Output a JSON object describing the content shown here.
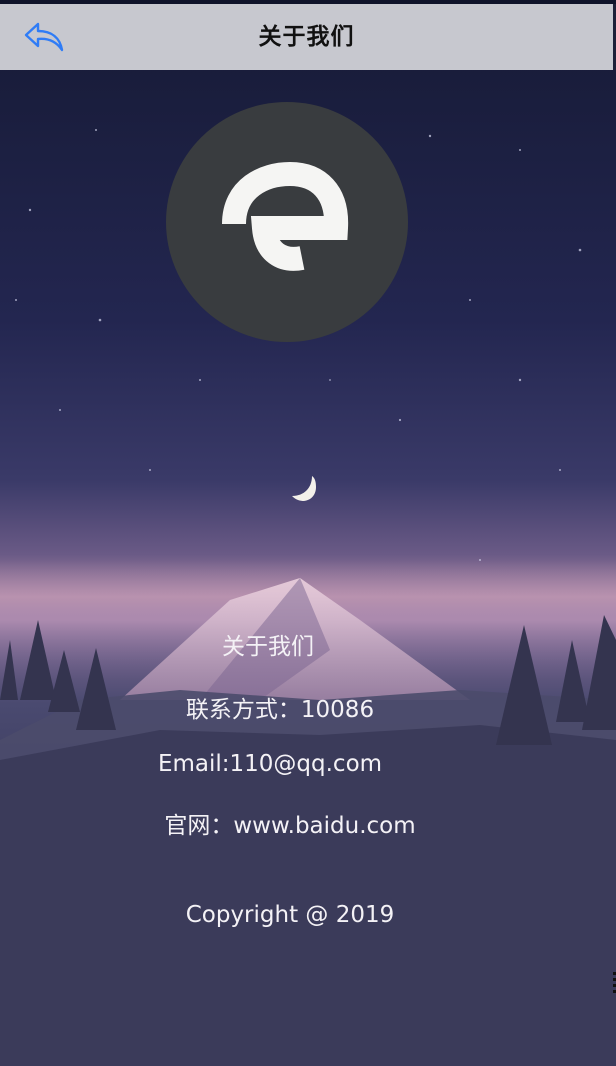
{
  "header": {
    "title": "关于我们",
    "back_icon": "reply-arrow-icon",
    "accent_color": "#2f7cf6"
  },
  "logo": {
    "letter": "e",
    "background": "#393c3f",
    "letter_color": "#f5f5f3"
  },
  "content": {
    "about_title": "关于我们",
    "contact": "联系方式：10086",
    "email": "Email:110@qq.com",
    "website": "官网：www.baidu.com",
    "copyright": "Copyright @ 2019"
  },
  "background": {
    "scene": "night-sky-mountains",
    "moon_icon": "crescent-moon-icon",
    "colors": {
      "sky_top": "#1a1d3a",
      "sky_mid": "#2c2e57",
      "horizon": "#8a6f9a",
      "ground": "#33344f"
    }
  }
}
